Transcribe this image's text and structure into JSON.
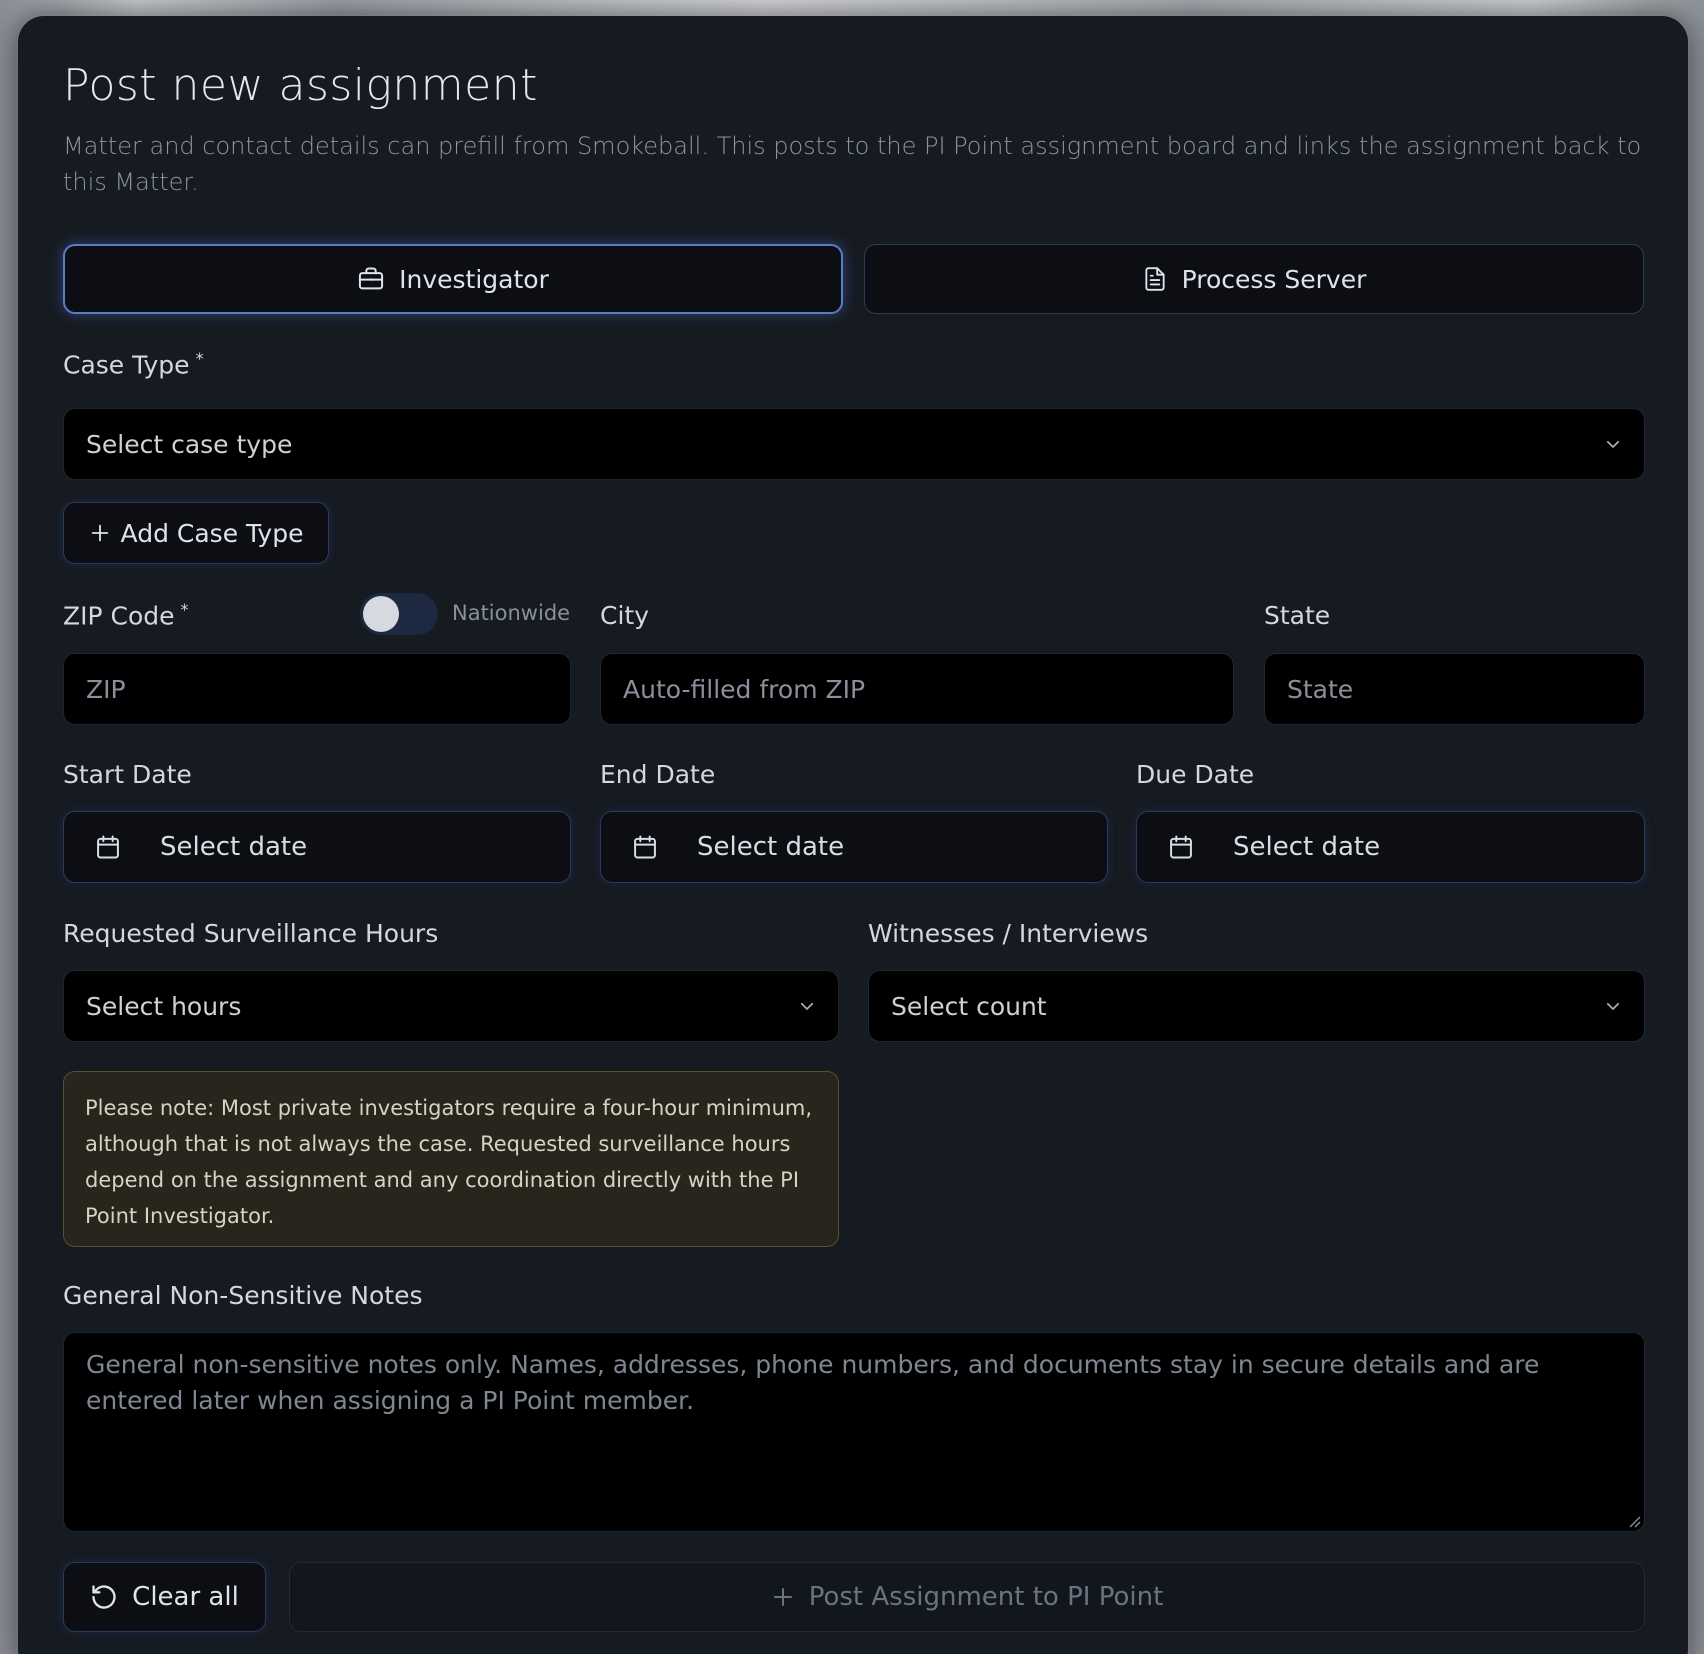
{
  "header": {
    "title": "Post new assignment",
    "subtitle": "Matter and contact details can prefill from Smokeball. This posts to the PI Point assignment board and links the assignment back to this Matter."
  },
  "tabs": [
    {
      "label": "Investigator",
      "icon": "briefcase-icon",
      "active": true
    },
    {
      "label": "Process Server",
      "icon": "document-icon",
      "active": false
    }
  ],
  "case_type": {
    "label": "Case Type",
    "required_mark": "*",
    "value": "Select case type",
    "add_label": "Add Case Type"
  },
  "location": {
    "zip_label": "ZIP Code",
    "zip_required": "*",
    "zip_placeholder": "ZIP",
    "nationwide_label": "Nationwide",
    "nationwide_on": false,
    "city_label": "City",
    "city_placeholder": "Auto-filled from ZIP",
    "state_label": "State",
    "state_placeholder": "State"
  },
  "dates": {
    "start_label": "Start Date",
    "end_label": "End Date",
    "due_label": "Due Date",
    "placeholder": "Select date"
  },
  "hours": {
    "label": "Requested Surveillance Hours",
    "value": "Select hours"
  },
  "witnesses": {
    "label": "Witnesses / Interviews",
    "value": "Select count"
  },
  "note": "Please note: Most private investigators require a four-hour minimum, although that is not always the case. Requested surveillance hours depend on the assignment and any coordination directly with the PI Point Investigator.",
  "notes_field": {
    "label": "General Non-Sensitive Notes",
    "placeholder": "General non-sensitive notes only. Names, addresses, phone numbers, and documents stay in secure details and are entered later when assigning a PI Point member."
  },
  "actions": {
    "clear_label": "Clear all",
    "post_label": "Post Assignment to PI Point"
  },
  "colors": {
    "panel": "#161a21",
    "accent": "#5b7bc4",
    "note_bg": "#27251c"
  }
}
